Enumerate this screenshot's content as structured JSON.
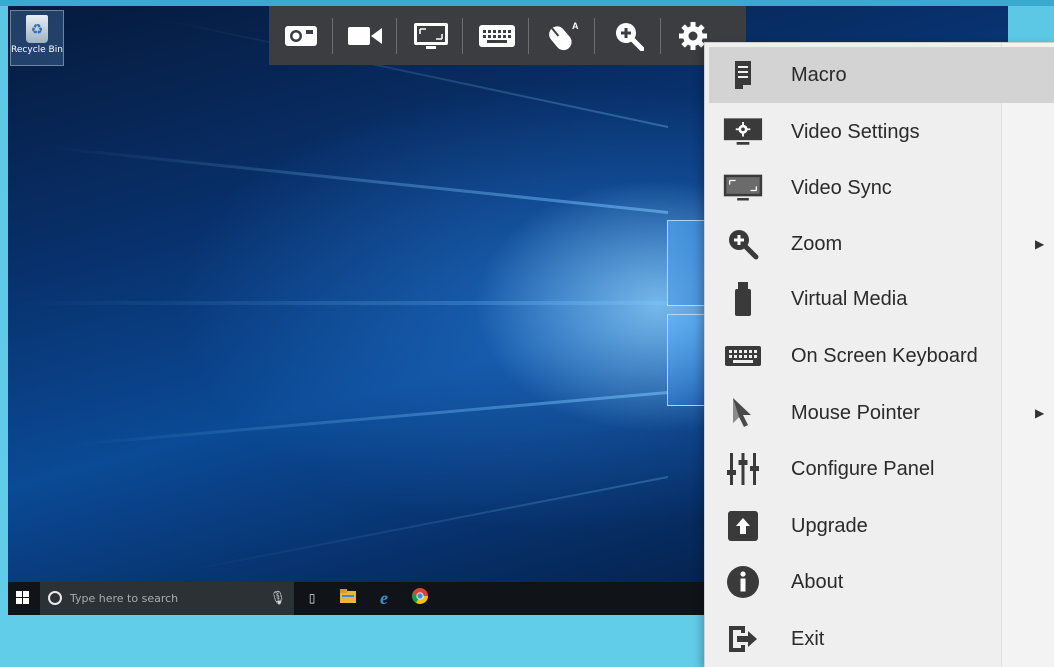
{
  "desktop": {
    "recycle_bin_label": "Recycle Bin",
    "search_placeholder": "Type here to search"
  },
  "toolbar": {
    "items": [
      {
        "name": "capture-screen-icon"
      },
      {
        "name": "record-video-icon"
      },
      {
        "name": "video-sync-icon"
      },
      {
        "name": "keyboard-icon"
      },
      {
        "name": "mouse-pointer-icon"
      },
      {
        "name": "zoom-icon"
      },
      {
        "name": "settings-gear-icon"
      }
    ]
  },
  "menu": {
    "items": [
      {
        "label": "Macro",
        "icon": "macro-icon",
        "active": true,
        "submenu": false
      },
      {
        "label": "Video Settings",
        "icon": "video-settings-icon",
        "active": false,
        "submenu": false
      },
      {
        "label": "Video Sync",
        "icon": "video-sync-icon",
        "active": false,
        "submenu": false
      },
      {
        "label": "Zoom",
        "icon": "zoom-icon",
        "active": false,
        "submenu": true
      },
      {
        "label": "Virtual Media",
        "icon": "virtual-media-icon",
        "active": false,
        "submenu": false
      },
      {
        "label": "On Screen Keyboard",
        "icon": "keyboard-icon",
        "active": false,
        "submenu": false
      },
      {
        "label": "Mouse Pointer",
        "icon": "mouse-pointer-icon",
        "active": false,
        "submenu": true
      },
      {
        "label": "Configure Panel",
        "icon": "sliders-icon",
        "active": false,
        "submenu": false
      },
      {
        "label": "Upgrade",
        "icon": "upgrade-icon",
        "active": false,
        "submenu": false
      },
      {
        "label": "About",
        "icon": "info-icon",
        "active": false,
        "submenu": false
      },
      {
        "label": "Exit",
        "icon": "exit-icon",
        "active": false,
        "submenu": false
      }
    ],
    "submenu_arrow": "▶"
  },
  "colors": {
    "toolbar_bg": "#3b3d41",
    "menu_bg": "#efefef",
    "menu_active": "#d3d3d3",
    "icon_dark": "#3a3a3a"
  }
}
